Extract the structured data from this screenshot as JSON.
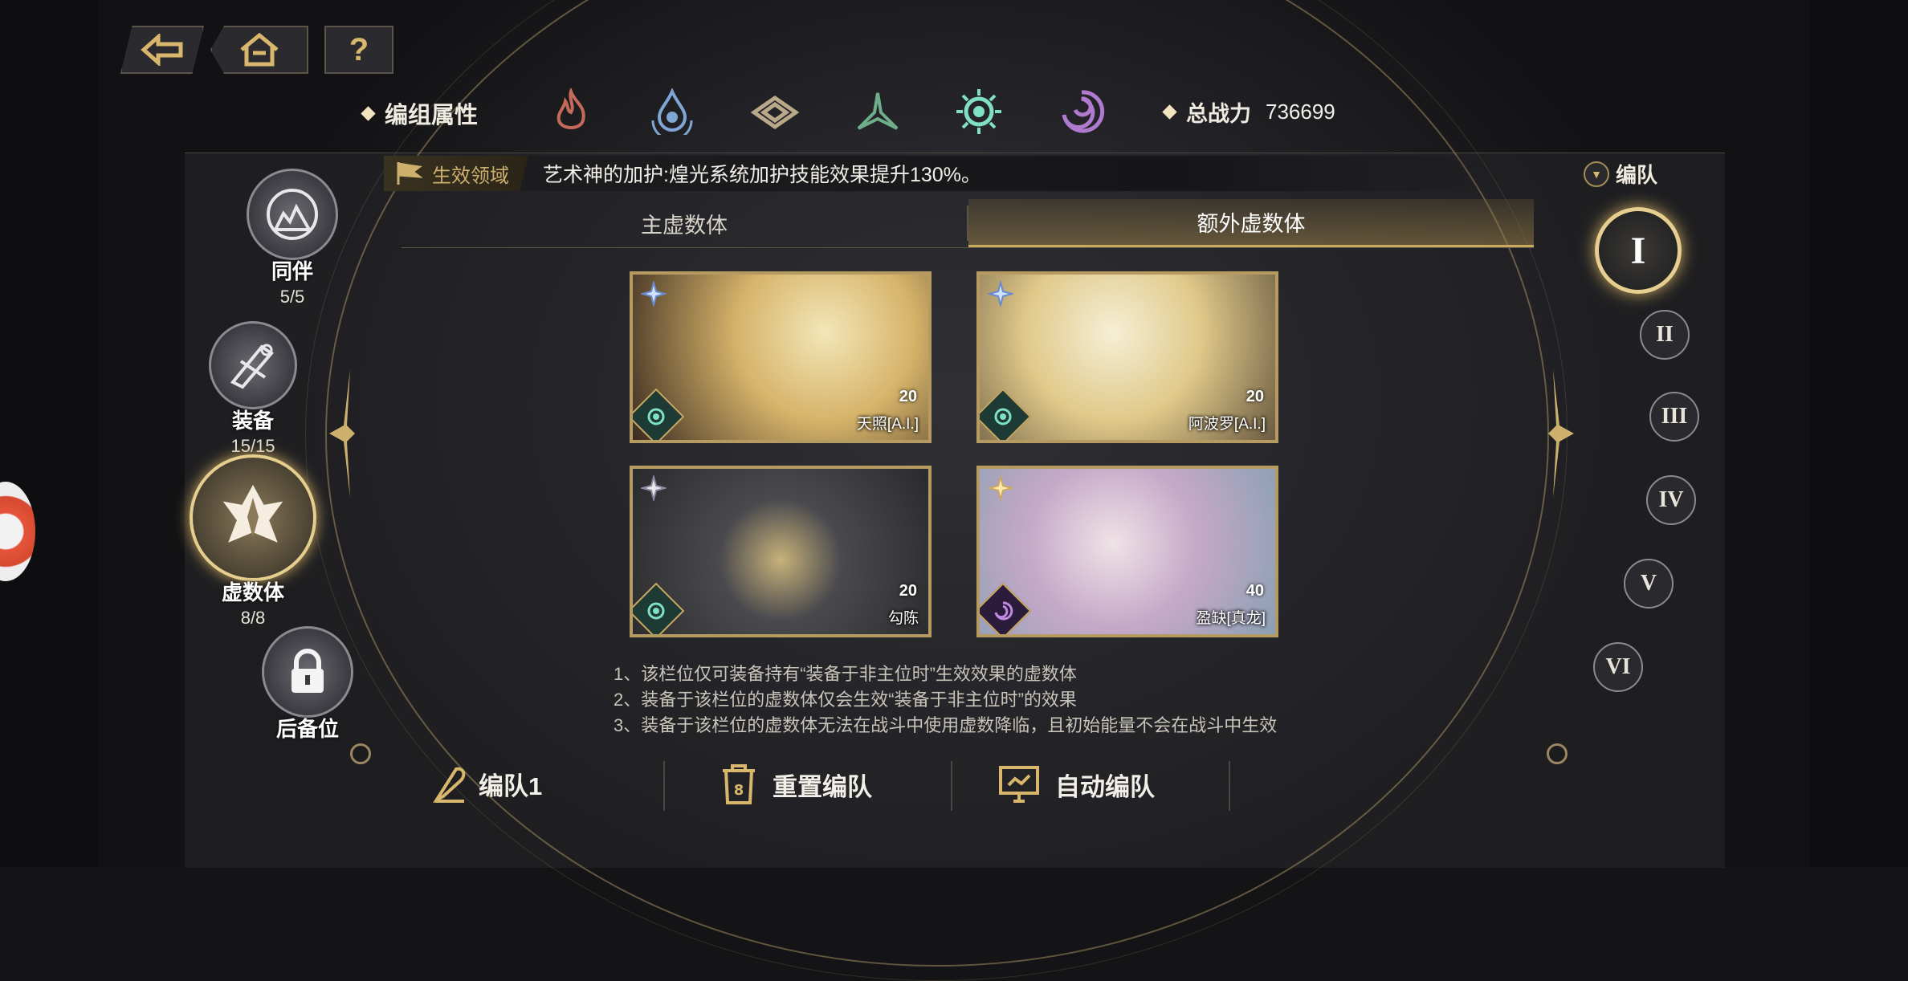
{
  "header": {
    "attr_title": "编组属性",
    "elements": [
      {
        "icon": "fire-element-icon",
        "color": "#c46a5a"
      },
      {
        "icon": "water-element-icon",
        "color": "#7fa6d4"
      },
      {
        "icon": "earth-element-icon",
        "color": "#b9a98a"
      },
      {
        "icon": "wind-element-icon",
        "color": "#6fae8a"
      },
      {
        "icon": "light-element-icon",
        "color": "#7fe0c6"
      },
      {
        "icon": "dark-element-icon",
        "color": "#b07ad0"
      }
    ],
    "power_label": "总战力",
    "power_value": "736699"
  },
  "domain": {
    "tag": "生效领域",
    "text": "艺术神的加护:煌光系统加护技能效果提升130%。"
  },
  "formation_label": "编队",
  "tabs": [
    {
      "label": "主虚数体",
      "active": false
    },
    {
      "label": "额外虚数体",
      "active": true
    }
  ],
  "sidebar": [
    {
      "name": "同伴",
      "count": "5/5",
      "icon": "companion-icon",
      "selected": false
    },
    {
      "name": "装备",
      "count": "15/15",
      "icon": "equipment-icon",
      "selected": false
    },
    {
      "name": "虚数体",
      "count": "8/8",
      "icon": "imaginary-icon",
      "selected": true
    },
    {
      "name": "后备位",
      "count": "",
      "icon": "lock-icon",
      "selected": false
    }
  ],
  "teams": [
    {
      "label": "I",
      "selected": true
    },
    {
      "label": "II",
      "selected": false
    },
    {
      "label": "III",
      "selected": false
    },
    {
      "label": "IV",
      "selected": false
    },
    {
      "label": "V",
      "selected": false
    },
    {
      "label": "VI",
      "selected": false
    }
  ],
  "cards": [
    {
      "name": "天照[A.I.]",
      "level": "20",
      "element": "light",
      "palette": [
        "#f3e6b8",
        "#d6b46a",
        "#3a2a20"
      ]
    },
    {
      "name": "阿波罗[A.I.]",
      "level": "20",
      "element": "light",
      "palette": [
        "#f6efd6",
        "#e0c98a",
        "#6a5a40"
      ]
    },
    {
      "name": "勾陈",
      "level": "20",
      "element": "light",
      "palette": [
        "#4a4a4e",
        "#2a2a2c",
        "#c8b27a"
      ]
    },
    {
      "name": "盈缺[真龙]",
      "level": "40",
      "element": "dark",
      "palette": [
        "#efe3e6",
        "#c6a8c8",
        "#8aa0b4"
      ]
    }
  ],
  "notes": [
    "1、该栏位仅可装备持有“装备于非主位时”生效效果的虚数体",
    "2、装备于该栏位的虚数体仅会生效“装备于非主位时”的效果",
    "3、装备于该栏位的虚数体无法在战斗中使用虚数降临，且初始能量不会在战斗中生效"
  ],
  "bottom": {
    "team_name": "编队1",
    "reset_label": "重置编队",
    "auto_label": "自动编队"
  },
  "nav": {
    "back": "back-icon",
    "home": "home-icon",
    "help": "?"
  }
}
